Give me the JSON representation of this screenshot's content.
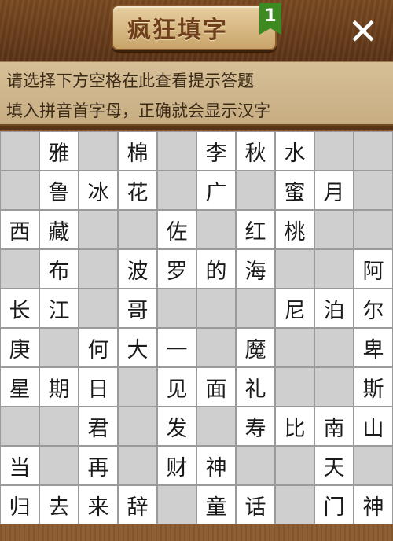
{
  "header": {
    "title": "疯狂填字",
    "level": "1",
    "close_icon": "close-icon"
  },
  "hints": {
    "line1": "请选择下方空格在此查看提示答题",
    "line2": "填入拼音首字母，正确就会显示汉字"
  },
  "grid": {
    "rows": [
      [
        "",
        "雅",
        "",
        "棉",
        "",
        "李",
        "秋",
        "水",
        "",
        ""
      ],
      [
        "",
        "鲁",
        "冰",
        "花",
        "",
        "广",
        "",
        "蜜",
        "月",
        ""
      ],
      [
        "西",
        "藏",
        "",
        "",
        "佐",
        "",
        "红",
        "桃",
        "",
        ""
      ],
      [
        "",
        "布",
        "",
        "波",
        "罗",
        "的",
        "海",
        "",
        "",
        "阿"
      ],
      [
        "长",
        "江",
        "",
        "哥",
        "",
        "",
        "",
        "尼",
        "泊",
        "尔"
      ],
      [
        "庚",
        "",
        "何",
        "大",
        "一",
        "",
        "魔",
        "",
        "",
        "卑"
      ],
      [
        "星",
        "期",
        "日",
        "",
        "见",
        "面",
        "礼",
        "",
        "",
        "斯"
      ],
      [
        "",
        "",
        "君",
        "",
        "发",
        "",
        "寿",
        "比",
        "南",
        "山"
      ],
      [
        "当",
        "",
        "再",
        "",
        "财",
        "神",
        "",
        "",
        "天",
        ""
      ],
      [
        "归",
        "去",
        "来",
        "辞",
        "",
        "童",
        "话",
        "",
        "门",
        "神"
      ]
    ],
    "types": [
      [
        "e",
        "f",
        "e",
        "f",
        "e",
        "f",
        "f",
        "f",
        "e",
        "e"
      ],
      [
        "e",
        "f",
        "f",
        "f",
        "e",
        "f",
        "e",
        "f",
        "f",
        "e"
      ],
      [
        "f",
        "f",
        "e",
        "e",
        "f",
        "e",
        "f",
        "f",
        "e",
        "e"
      ],
      [
        "e",
        "f",
        "e",
        "f",
        "f",
        "f",
        "f",
        "e",
        "e",
        "f"
      ],
      [
        "f",
        "f",
        "e",
        "f",
        "e",
        "e",
        "e",
        "f",
        "f",
        "f"
      ],
      [
        "f",
        "e",
        "f",
        "f",
        "f",
        "e",
        "f",
        "e",
        "e",
        "f"
      ],
      [
        "f",
        "f",
        "f",
        "e",
        "f",
        "f",
        "f",
        "e",
        "e",
        "f"
      ],
      [
        "e",
        "e",
        "f",
        "e",
        "f",
        "e",
        "f",
        "f",
        "f",
        "f"
      ],
      [
        "f",
        "e",
        "f",
        "e",
        "f",
        "f",
        "e",
        "e",
        "f",
        "e"
      ],
      [
        "f",
        "f",
        "f",
        "f",
        "e",
        "f",
        "f",
        "e",
        "f",
        "f"
      ]
    ]
  }
}
